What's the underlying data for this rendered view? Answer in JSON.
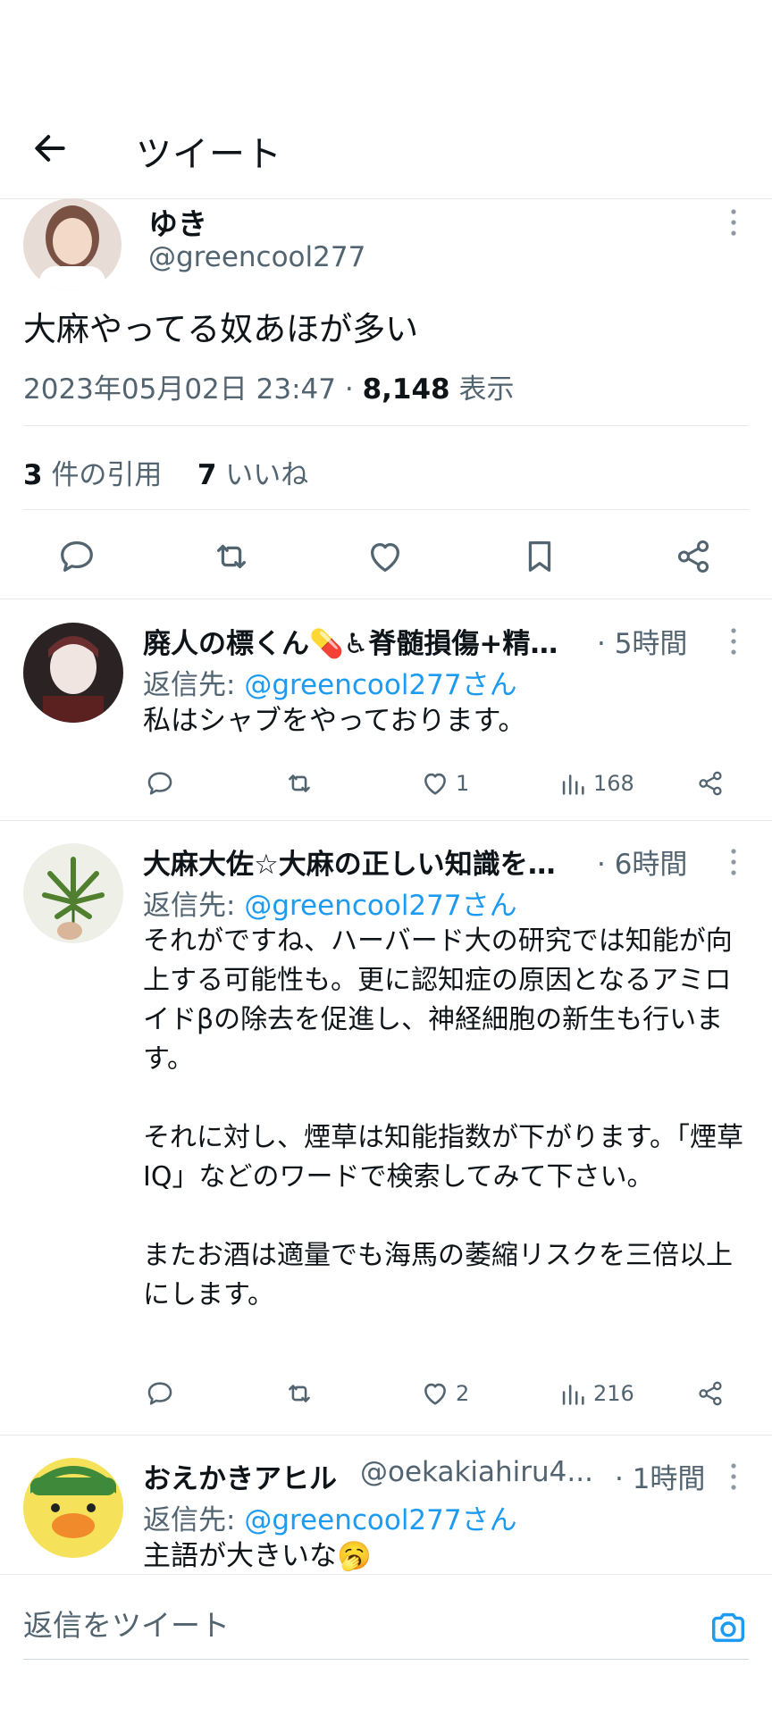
{
  "header": {
    "title": "ツイート"
  },
  "main_tweet": {
    "name": "ゆき",
    "handle": "@greencool277",
    "text": "大麻やってる奴あほが多い",
    "timestamp": "2023年05月02日 23:47",
    "sep": "·",
    "views": "8,148",
    "views_label": "表示",
    "quotes_count": "3",
    "quotes_label": "件の引用",
    "likes_count": "7",
    "likes_label": "いいね"
  },
  "replies": [
    {
      "name": "廃人の標くん💊♿脊髄損傷+精…",
      "time": "· 5時間",
      "reply_prefix": "返信先: ",
      "reply_handle": "@greencool277さん",
      "text": "私はシャブをやっております。",
      "likes": "1",
      "views": "168"
    },
    {
      "name": "大麻大佐☆大麻の正しい知識を…",
      "time": "· 6時間",
      "reply_prefix": "返信先: ",
      "reply_handle": "@greencool277さん",
      "text": "それがですね、ハーバード大の研究では知能が向上する可能性も。更に認知症の原因となるアミロイドβの除去を促進し、神経細胞の新生も行います。\n\nそれに対し、煙草は知能指数が下がります。「煙草　IQ」などのワードで検索してみて下さい。\n\nまたお酒は適量でも海馬の萎縮リスクを三倍以上にします。",
      "likes": "2",
      "views": "216"
    },
    {
      "name": "おえかきアヒル",
      "handle": "@oekakiahiru4...",
      "time": "· 1時間",
      "reply_prefix": "返信先: ",
      "reply_handle": "@greencool277さん",
      "text": "主語が大きいな🥱"
    }
  ],
  "composer": {
    "placeholder": "返信をツイート"
  },
  "colors": {
    "accent": "#1d9bf0",
    "secondary_text": "#536471",
    "divider": "#e6e9ec"
  }
}
